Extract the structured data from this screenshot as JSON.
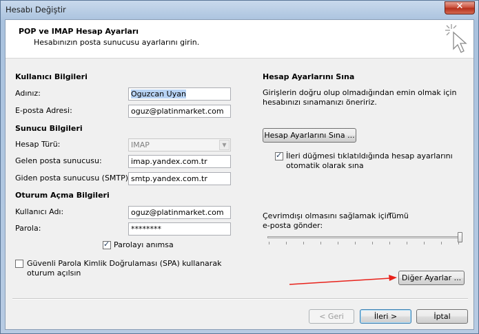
{
  "window": {
    "title": "Hesabı Değiştir",
    "close_label": "✕"
  },
  "header": {
    "title": "POP ve IMAP Hesap Ayarları",
    "subtitle": "Hesabınızın posta sunucusu ayarlarını girin."
  },
  "user_info": {
    "section": "Kullanıcı Bilgileri",
    "name_label": "Adınız:",
    "name_value": "Oguzcan Uyan",
    "email_label": "E-posta Adresi:",
    "email_value": "oguz@platinmarket.com"
  },
  "server_info": {
    "section": "Sunucu Bilgileri",
    "account_type_label": "Hesap Türü:",
    "account_type_value": "IMAP",
    "incoming_label": "Gelen posta sunucusu:",
    "incoming_value": "imap.yandex.com.tr",
    "outgoing_label": "Giden posta sunucusu (SMTP):",
    "outgoing_value": "smtp.yandex.com.tr"
  },
  "logon_info": {
    "section": "Oturum Açma Bilgileri",
    "username_label": "Kullanıcı Adı:",
    "username_value": "oguz@platinmarket.com",
    "password_label": "Parola:",
    "password_value": "********",
    "remember_label": "Parolayı anımsa",
    "remember_checked": true,
    "spa_label_line1": "Güvenli Parola Kimlik Doğrulaması (SPA) kullanarak",
    "spa_label_line2": "oturum açılsın",
    "spa_checked": false
  },
  "test": {
    "section": "Hesap Ayarlarını Sına",
    "desc_line1": "Girişlerin doğru olup olmadığından emin olmak için",
    "desc_line2": "hesabınızı sınamanızı öneririz.",
    "test_button": "Hesap Ayarlarını Sına ...",
    "auto_test_line1": "İleri düğmesi tıklatıldığında hesap ayarlarını",
    "auto_test_line2": "otomatik olarak sına",
    "auto_test_checked": true
  },
  "offline": {
    "label_line1": "Çevrimdışı olmasını sağlamak için",
    "value": "Tümü",
    "label_line2": "e-posta gönder:",
    "slider_level": 1.0
  },
  "buttons": {
    "more_settings": "Diğer Ayarlar ...",
    "back": "< Geri",
    "next": "İleri >",
    "cancel": "İptal"
  },
  "colors": {
    "annotation_arrow": "#e8211a",
    "title_bar": "#b7cbe3"
  }
}
